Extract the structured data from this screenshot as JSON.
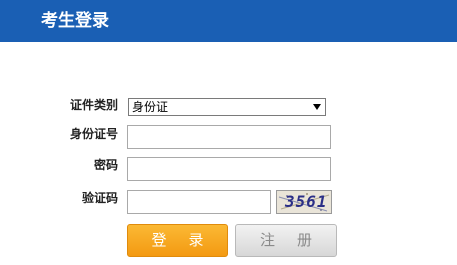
{
  "header": {
    "title": "考生登录",
    "color": "#1a5fb4"
  },
  "form": {
    "type_label": "证件类别",
    "type_value": "身份证",
    "id_label": "身份证号",
    "id_value": "",
    "password_label": "密码",
    "password_value": "",
    "captcha_label": "验证码",
    "captcha_value": "",
    "captcha_image_text": "3561"
  },
  "buttons": {
    "login_label": "登录",
    "register_label": "注册",
    "login_color": "#f39a12"
  }
}
